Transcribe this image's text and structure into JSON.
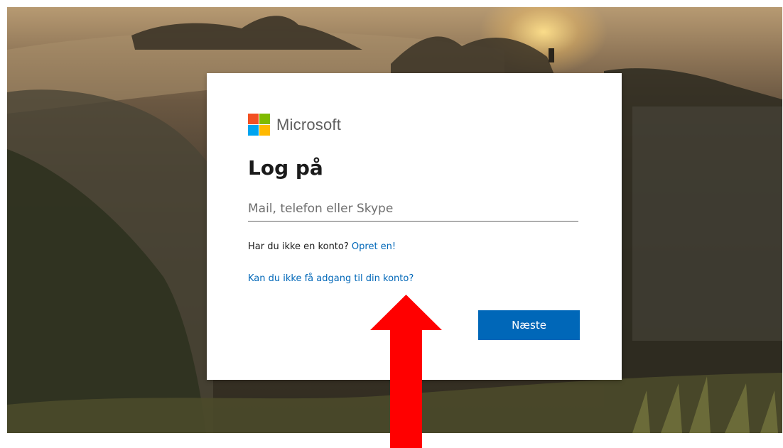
{
  "brand": {
    "name": "Microsoft",
    "logo_colors": [
      "#f25022",
      "#7fba00",
      "#00a4ef",
      "#ffb900"
    ]
  },
  "signin": {
    "title": "Log på",
    "email_placeholder": "Mail, telefon eller Skype",
    "email_value": "",
    "no_account_text": "Har du ikke en konto?",
    "create_account_link": "Opret en!",
    "cant_access_link": "Kan du ikke få adgang til din konto?",
    "next_button": "Næste"
  },
  "annotation": {
    "arrow_color": "#ff0000",
    "arrow_icon": "up-arrow-icon"
  },
  "colors": {
    "accent": "#0067b8",
    "card": "#ffffff"
  }
}
